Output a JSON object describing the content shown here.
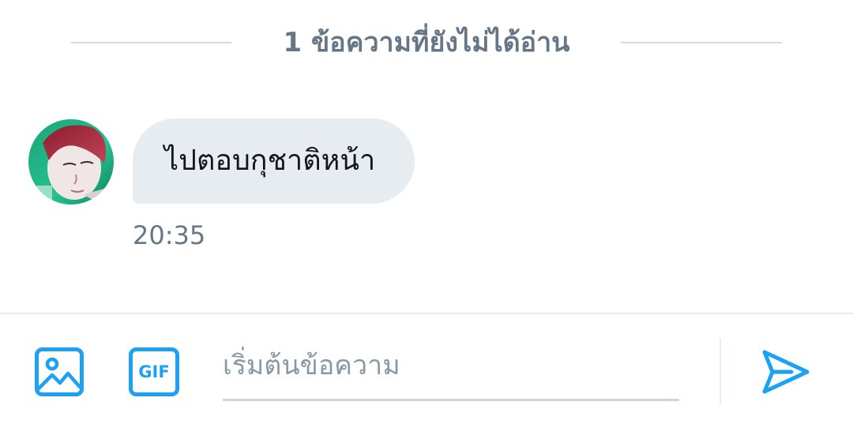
{
  "divider": {
    "unread_label": "1 ข้อความที่ยังไม่ได้อ่าน"
  },
  "conversation": {
    "messages": [
      {
        "text": "ไปตอบกุชาติหน้า",
        "time": "20:35",
        "avatar": "user-avatar"
      }
    ]
  },
  "composer": {
    "placeholder": "เริ่มต้นข้อความ",
    "value": "",
    "gif_label": "GIF",
    "image_icon": "image-icon",
    "send_icon": "send-icon"
  },
  "colors": {
    "accent": "#1da1f2",
    "bubble_bg": "#e6ecf0",
    "muted_text": "#657786",
    "divider": "#d3dbe1"
  }
}
